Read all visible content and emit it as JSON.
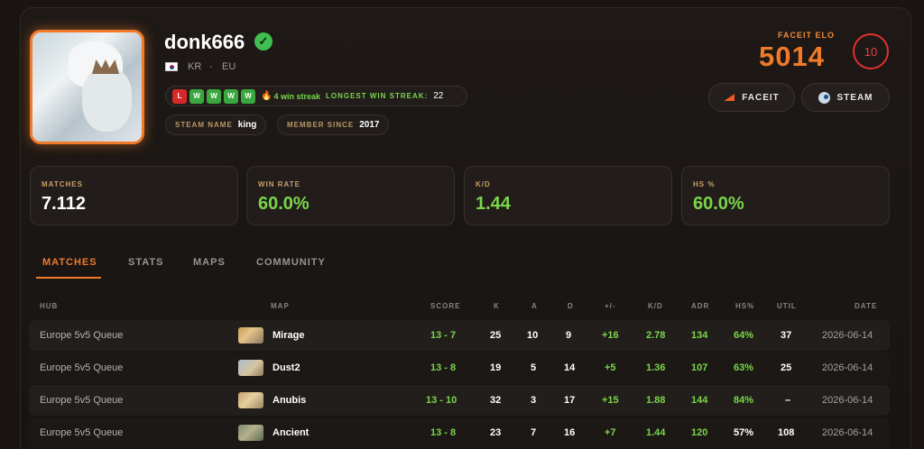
{
  "profile": {
    "username": "donk666",
    "verified_glyph": "✓",
    "country_code": "KR",
    "region": "EU",
    "separator": "·",
    "recent_results": [
      "L",
      "W",
      "W",
      "W",
      "W"
    ],
    "win_streak_text": "4 win streak",
    "longest_streak_label": "LONGEST WIN STREAK:",
    "longest_streak_value": "22",
    "steam_name_label": "STEAM NAME",
    "steam_name_value": "king",
    "member_since_label": "MEMBER SINCE",
    "member_since_value": "2017"
  },
  "elo": {
    "label": "FACEIT ELO",
    "value": "5014",
    "level": "10"
  },
  "links": {
    "faceit_label": "FACEIT",
    "steam_label": "STEAM"
  },
  "stats": [
    {
      "label": "MATCHES",
      "value": "7.112"
    },
    {
      "label": "WIN RATE",
      "value": "60.0%"
    },
    {
      "label": "K/D",
      "value": "1.44"
    },
    {
      "label": "HS %",
      "value": "60.0%"
    }
  ],
  "tabs": [
    "MATCHES",
    "STATS",
    "MAPS",
    "COMMUNITY"
  ],
  "table": {
    "headers": [
      "HUB",
      "MAP",
      "SCORE",
      "K",
      "A",
      "D",
      "+/-",
      "K/D",
      "ADR",
      "HS%",
      "UTIL",
      "DATE"
    ],
    "rows": [
      {
        "hub": "Europe 5v5 Queue",
        "map": "Mirage",
        "score": "13 - 7",
        "k": "25",
        "a": "10",
        "d": "9",
        "pm": "+16",
        "kd": "2.78",
        "adr": "134",
        "hs": "64%",
        "util": "37",
        "date": "2026-06-14"
      },
      {
        "hub": "Europe 5v5 Queue",
        "map": "Dust2",
        "score": "13 - 8",
        "k": "19",
        "a": "5",
        "d": "14",
        "pm": "+5",
        "kd": "1.36",
        "adr": "107",
        "hs": "63%",
        "util": "25",
        "date": "2026-06-14"
      },
      {
        "hub": "Europe 5v5 Queue",
        "map": "Anubis",
        "score": "13 - 10",
        "k": "32",
        "a": "3",
        "d": "17",
        "pm": "+15",
        "kd": "1.88",
        "adr": "144",
        "hs": "84%",
        "util": "–",
        "date": "2026-06-14"
      },
      {
        "hub": "Europe 5v5 Queue",
        "map": "Ancient",
        "score": "13 - 8",
        "k": "23",
        "a": "7",
        "d": "16",
        "pm": "+7",
        "kd": "1.44",
        "adr": "120",
        "hs": "57%",
        "util": "108",
        "date": "2026-06-14"
      }
    ]
  },
  "icons": {
    "verified": "verified-check-icon",
    "flag": "kr-flag-icon",
    "fire": "fire-icon",
    "faceit": "faceit-logo-icon",
    "steam": "steam-logo-icon"
  },
  "colors": {
    "accent": "#f07a2a",
    "positive": "#7ad64a",
    "loss": "#d62a2a",
    "win": "#3aa83f",
    "level": "#e03030"
  }
}
